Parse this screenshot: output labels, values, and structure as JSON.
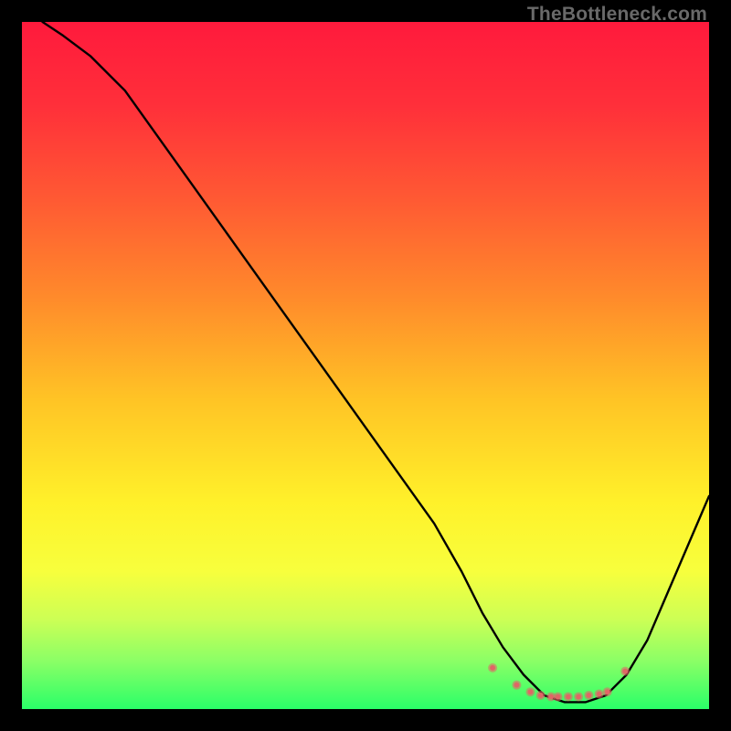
{
  "watermark": "TheBottleneck.com",
  "chart_data": {
    "type": "line",
    "title": "",
    "xlabel": "",
    "ylabel": "",
    "xlim": [
      0,
      100
    ],
    "ylim": [
      0,
      100
    ],
    "series": [
      {
        "name": "curve",
        "color": "#000000",
        "x": [
          3,
          6,
          10,
          15,
          20,
          25,
          30,
          35,
          40,
          45,
          50,
          55,
          60,
          64,
          67,
          70,
          73,
          76,
          79,
          82,
          85,
          88,
          91,
          94,
          97,
          100
        ],
        "y": [
          100,
          98,
          95,
          90,
          83,
          76,
          69,
          62,
          55,
          48,
          41,
          34,
          27,
          20,
          14,
          9,
          5,
          2,
          1,
          1,
          2,
          5,
          10,
          17,
          24,
          31
        ]
      }
    ],
    "markers": {
      "name": "dots",
      "color": "#e06666",
      "radius_outer": 5.0,
      "radius_inner": 3.0,
      "x": [
        68.5,
        72.0,
        74.0,
        75.5,
        77.0,
        78.0,
        79.5,
        81.0,
        82.5,
        84.0,
        85.2,
        87.8
      ],
      "y": [
        6.0,
        3.5,
        2.5,
        2.0,
        1.8,
        1.8,
        1.8,
        1.8,
        2.0,
        2.2,
        2.5,
        5.5
      ]
    },
    "gradient_stops": [
      {
        "offset": 0.0,
        "color": "#ff1a3c"
      },
      {
        "offset": 0.12,
        "color": "#ff2f3a"
      },
      {
        "offset": 0.26,
        "color": "#ff5a33"
      },
      {
        "offset": 0.4,
        "color": "#ff8a2b"
      },
      {
        "offset": 0.55,
        "color": "#ffc425"
      },
      {
        "offset": 0.7,
        "color": "#fff12a"
      },
      {
        "offset": 0.8,
        "color": "#f7ff3d"
      },
      {
        "offset": 0.87,
        "color": "#ccff55"
      },
      {
        "offset": 0.93,
        "color": "#8bff66"
      },
      {
        "offset": 1.0,
        "color": "#2aff68"
      }
    ]
  }
}
